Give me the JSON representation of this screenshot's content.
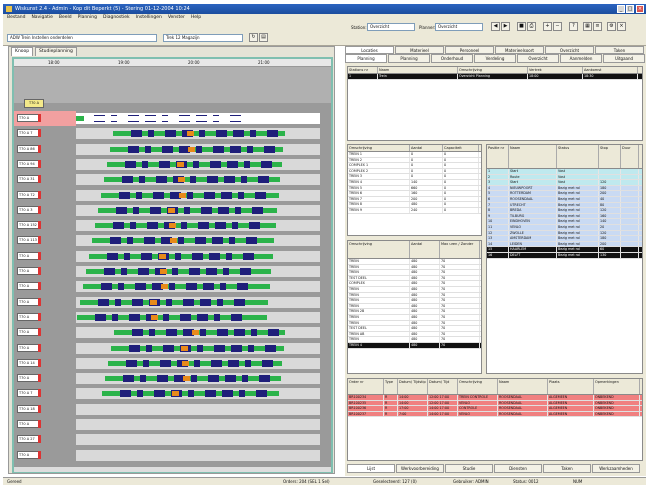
{
  "window": {
    "title": "Wiskunst 2.4 - Admin - Kop dit Beperkt (5) - Stering 01-12-2004 10:24",
    "min": "_",
    "max": "□",
    "close": "×"
  },
  "menu": [
    "Bestand",
    "Navigatie",
    "Beeld",
    "Planning",
    "Diagnostiek",
    "Instellingen",
    "Venster",
    "Help"
  ],
  "toolbar": {
    "filter1": "ADW Trein Instellen onderdelen",
    "filter2": "Trek 12 Magazijn",
    "station_label": "Station:",
    "station_value": "Overzicht",
    "planner_label": "Planner:",
    "planner_value": "Overzicht"
  },
  "left_panel": {
    "tabs": [
      "Knoop",
      "Studieplanning"
    ],
    "time_ticks": [
      "18:00",
      "19:00",
      "20:00",
      "21:00"
    ],
    "selected_label": "T70 A",
    "rows": [
      "T70 A",
      "T70 A 7",
      "T70 A 86",
      "T70 A 94",
      "T70 A 31",
      "T70 A 72",
      "T70 A 3",
      "T70 A 152",
      "T70 A 113",
      "T70 A",
      "T70 A",
      "T70 A",
      "T70 A",
      "T70 A",
      "T70 A",
      "T70 A",
      "T70 A 14",
      "T70 A",
      "T70 A 7",
      "T70 A 18",
      "T70 A",
      "T70 A 27",
      "T70 A"
    ]
  },
  "right_tabs_top": [
    "Locaties",
    "Materieel",
    "Personeel",
    "Materieelsoort",
    "Overzicht",
    "Taken"
  ],
  "right_tabs_second": [
    "Planning",
    "Planning",
    "Onderhoud",
    "Verdeling",
    "Overzicht",
    "Aanmelden",
    "Uitgaand"
  ],
  "top_grid": {
    "headers": [
      "Stations nr",
      "Naam",
      "Omschrijving",
      "Vertrek",
      "Aankomst"
    ],
    "rows": [
      [
        "1",
        "Trein",
        "Overzicht Planning",
        "18:00",
        "18:30"
      ]
    ]
  },
  "mid_left_grid": {
    "headers": [
      "Omschrijving",
      "Aantal",
      "Capaciteit"
    ],
    "rows": [
      [
        "TREIN 1",
        "0",
        "0"
      ],
      [
        "TREIN 2",
        "0",
        "0"
      ],
      [
        "COMPLEX 1",
        "0",
        "0"
      ],
      [
        "COMPLEX 2",
        "0",
        "0"
      ],
      [
        "TREIN 3",
        "0",
        "0"
      ],
      [
        "TREIN 4",
        "140",
        "0"
      ],
      [
        "TREIN 5",
        "660",
        "0"
      ],
      [
        "TREIN 6",
        "160",
        "0"
      ],
      [
        "TREIN 7",
        "200",
        "0"
      ],
      [
        "TREIN 8",
        "480",
        "0"
      ],
      [
        "TREIN 9",
        "240",
        "0"
      ]
    ]
  },
  "mid_right_grid": {
    "headers": [
      "Positie nr",
      "Naam",
      "Status",
      "Stop",
      "Duur"
    ],
    "rows": [
      [
        "1",
        "Start",
        "Vast",
        "",
        ""
      ],
      [
        "2",
        "Route",
        "Vast",
        "",
        ""
      ],
      [
        "3",
        "Start",
        "Vast",
        "120",
        ""
      ],
      [
        "4",
        "NIEUWPOORT",
        "Bezig met rol",
        "180",
        ""
      ],
      [
        "5",
        "ROTTERDAM",
        "Bezig met rol",
        "200",
        ""
      ],
      [
        "6",
        "ROOSENDAAL",
        "Bezig met rol",
        "40",
        ""
      ],
      [
        "7",
        "UTRECHT",
        "Bezig met rol",
        "80",
        ""
      ],
      [
        "8",
        "BREDA",
        "Bezig met rol",
        "120",
        ""
      ],
      [
        "9",
        "TILBURG",
        "Bezig met rol",
        "160",
        ""
      ],
      [
        "10",
        "EINDHOVEN",
        "Bezig met rol",
        "140",
        ""
      ],
      [
        "11",
        "VENLO",
        "Bezig met rol",
        "20",
        ""
      ],
      [
        "12",
        "ZWOLLE",
        "Bezig met rol",
        "120",
        ""
      ],
      [
        "13",
        "AMSTERDAM",
        "Bezig met rol",
        "180",
        ""
      ],
      [
        "14",
        "LEIDEN",
        "Bezig met rol",
        "200",
        ""
      ],
      [
        "15",
        "HAARLEM",
        "Bezig met rol",
        "60",
        ""
      ],
      [
        "16",
        "DELFT",
        "Bezig met rol",
        "130",
        ""
      ]
    ]
  },
  "lower_left_grid": {
    "headers": [
      "Omschrijving",
      "Aantal",
      "Max uren / Zonder"
    ],
    "rows": [
      [
        "TREIN",
        "480",
        "70"
      ],
      [
        "TREIN",
        "480",
        "70"
      ],
      [
        "TREIN",
        "480",
        "70"
      ],
      [
        "TEST DEEL",
        "480",
        "70"
      ],
      [
        "COMPLEX",
        "480",
        "70"
      ],
      [
        "TREIN",
        "480",
        "70"
      ],
      [
        "TREIN",
        "480",
        "70"
      ],
      [
        "TREIN",
        "480",
        "70"
      ],
      [
        "TREIN",
        "480",
        "70"
      ],
      [
        "TREIN 2B",
        "480",
        "70"
      ],
      [
        "TREIN",
        "480",
        "70"
      ],
      [
        "TREIN",
        "480",
        "70"
      ],
      [
        "TEST DEEL",
        "480",
        "70"
      ],
      [
        "TREIN AB",
        "480",
        "70"
      ],
      [
        "TREIN",
        "480",
        "70"
      ],
      [
        "TREIN 4",
        "480",
        "70"
      ]
    ]
  },
  "bottom_grid": {
    "headers": [
      "Order nr",
      "Type",
      "Datum/ Tijdstip",
      "Datum/ Tijd",
      "Omschrijving",
      "Naam",
      "Plaats",
      "Opmerkingen"
    ],
    "rows": [
      [
        "BR100234",
        "R",
        "14:00",
        "12:00 17:00",
        "TREIN CONTROLE",
        "ROOSENDAAL",
        "ALGEMEEN",
        "ONBEKEND"
      ],
      [
        "BR100235",
        "R",
        "14:00",
        "12:00 17:00",
        "VENLO",
        "ROOSENDAAL",
        "ALGEMEEN",
        "ONBEKEND"
      ],
      [
        "BR100236",
        "R",
        "17:00",
        "14:00 17:00",
        "CONTROLE",
        "ROOSENDAAL",
        "ALGEMEEN",
        "ONBEKEND"
      ],
      [
        "BR100237",
        "R",
        "7:00",
        "14:00 17:00",
        "VENLO",
        "ROOSENDAAL",
        "ALGEMEEN",
        "ONBEKEND"
      ]
    ]
  },
  "bottom_tabs": [
    "Lijst",
    "Werkvoorbereiding",
    "Studie",
    "Diensten",
    "Taken",
    "Werkzaamheden"
  ],
  "status": {
    "ready": "Gereed",
    "orders": "Orders: 204 (SEL 1 Sel)",
    "records": "Geselecteerd: 127 (0)",
    "user": "Gebruiker: ADMIN",
    "page": "Status: 0012",
    "caps": "NUM"
  }
}
